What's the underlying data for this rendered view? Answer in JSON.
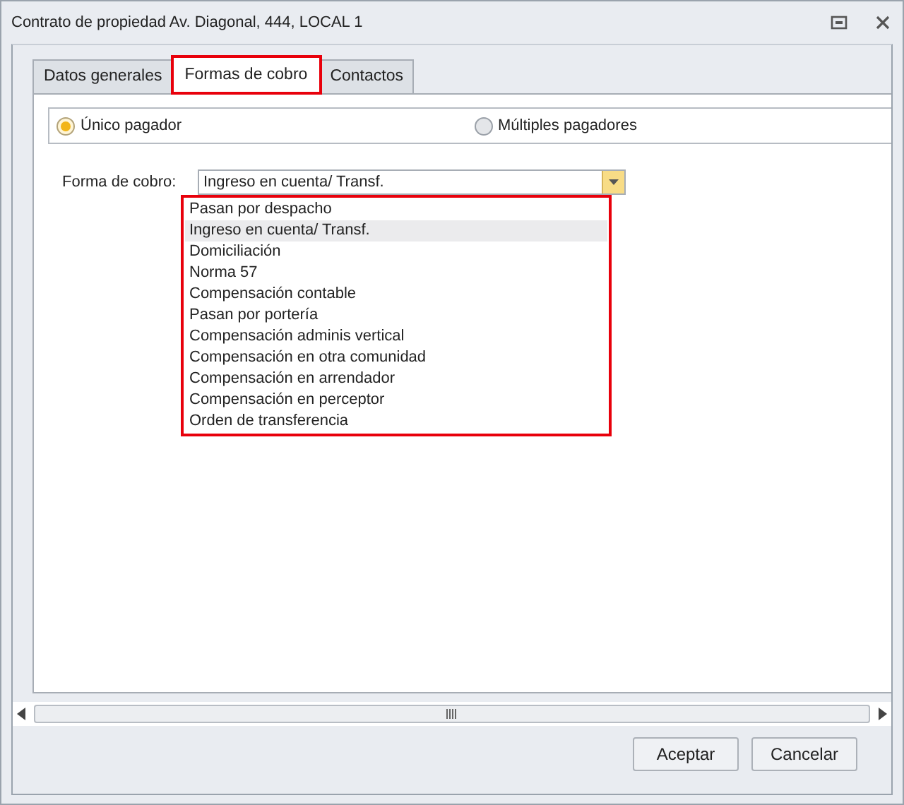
{
  "window": {
    "title": "Contrato de propiedad Av. Diagonal, 444, LOCAL 1"
  },
  "tabs": [
    {
      "label": "Datos generales",
      "selected": false,
      "highlighted": false
    },
    {
      "label": "Formas de cobro",
      "selected": true,
      "highlighted": true
    },
    {
      "label": "Contactos",
      "selected": false,
      "highlighted": false
    }
  ],
  "payer_options": [
    {
      "label": "Único pagador",
      "selected": true
    },
    {
      "label": "Múltiples pagadores",
      "selected": false
    }
  ],
  "payment_method": {
    "label": "Forma de cobro:",
    "value": "Ingreso en cuenta/ Transf.",
    "expanded": true,
    "highlighted": true,
    "options": [
      {
        "label": "Pasan por despacho",
        "selected": false
      },
      {
        "label": "Ingreso en cuenta/ Transf.",
        "selected": true
      },
      {
        "label": "Domiciliación",
        "selected": false
      },
      {
        "label": "Norma 57",
        "selected": false
      },
      {
        "label": "Compensación contable",
        "selected": false
      },
      {
        "label": "Pasan por portería",
        "selected": false
      },
      {
        "label": "Compensación adminis vertical",
        "selected": false
      },
      {
        "label": "Compensación en otra comunidad",
        "selected": false
      },
      {
        "label": "Compensación en arrendador",
        "selected": false
      },
      {
        "label": "Compensación en perceptor",
        "selected": false
      },
      {
        "label": "Orden de transferencia",
        "selected": false
      }
    ]
  },
  "buttons": [
    "Aceptar",
    "Cancelar"
  ]
}
